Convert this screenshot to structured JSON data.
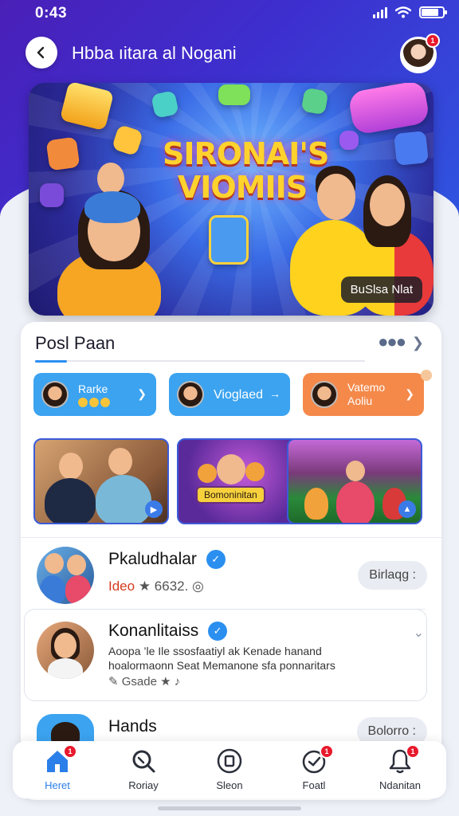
{
  "status": {
    "time": "0:43"
  },
  "header": {
    "title": "Hbba ıitara al Nogani",
    "avatar_badge": "1"
  },
  "hero": {
    "title_line1": "SIRONAI'S",
    "title_line2": "VIOMIIS",
    "badge": "BuSlsa Nlat"
  },
  "section": {
    "title": "Posl Paan"
  },
  "chips": [
    {
      "label": "Rarke",
      "color": "#3ba3f0"
    },
    {
      "label": "Vioglaed",
      "color": "#3ba3f0"
    },
    {
      "label_line1": "Vatemo",
      "label_line2": "Aoliu",
      "color": "#f5894a"
    }
  ],
  "thumbs": [
    {
      "caption": ""
    },
    {
      "caption": "Bomoninitan"
    },
    {
      "caption": ""
    }
  ],
  "list": [
    {
      "name": "Pkaludhalar",
      "meta_red": "Ideo",
      "meta": "★ 6632. ◎",
      "action": "Birlaqg :"
    },
    {
      "name": "Konanlitaiss",
      "desc1": "Aoopa ’le Ile ssosfaatiyl ak Kenade hanand",
      "desc2": "hoalormaonn Seat Memanone sfa ponnaritars",
      "meta": "✎ Gsade ★ ♪"
    },
    {
      "name": "Hands",
      "action": "Bolorro :"
    }
  ],
  "tabs": [
    {
      "label": "Heret",
      "badge": "1",
      "icon": "home-icon"
    },
    {
      "label": "Roriay",
      "icon": "search-icon"
    },
    {
      "label": "Sleon",
      "icon": "square-icon"
    },
    {
      "label": "Foatl",
      "badge": "1",
      "icon": "clock-icon"
    },
    {
      "label": "Ndanitan",
      "badge": "1",
      "icon": "bell-icon"
    }
  ]
}
